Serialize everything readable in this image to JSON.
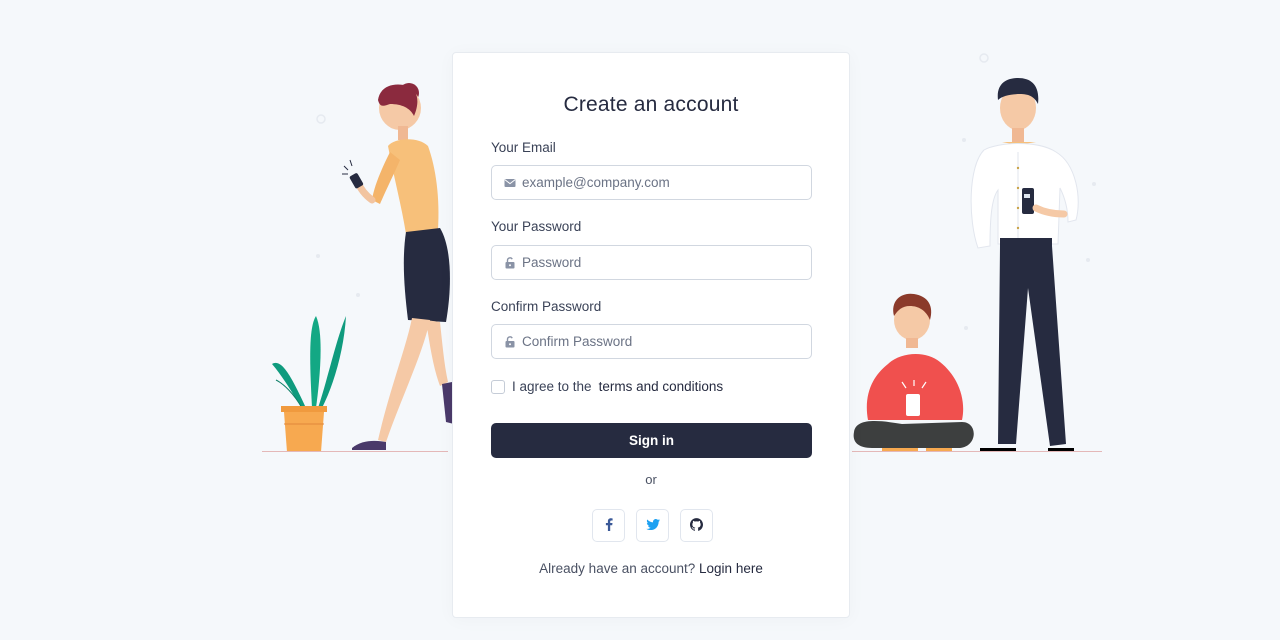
{
  "form": {
    "title": "Create an account",
    "email": {
      "label": "Your Email",
      "placeholder": "example@company.com",
      "value": ""
    },
    "password": {
      "label": "Your Password",
      "placeholder": "Password",
      "value": ""
    },
    "confirm": {
      "label": "Confirm Password",
      "placeholder": "Confirm Password",
      "value": ""
    },
    "agree": {
      "prefix": "I agree to the",
      "link": "terms and conditions",
      "checked": false
    },
    "submit_label": "Sign in",
    "or_label": "or",
    "footer": {
      "prompt": "Already have an account?",
      "link": "Login here"
    }
  },
  "social": [
    {
      "icon": "facebook-icon"
    },
    {
      "icon": "twitter-icon"
    },
    {
      "icon": "github-icon"
    }
  ],
  "colors": {
    "background": "#f5f8fb",
    "primary": "#262b40",
    "facebook": "#3b5998",
    "twitter": "#1da1f2",
    "github": "#262b40"
  }
}
